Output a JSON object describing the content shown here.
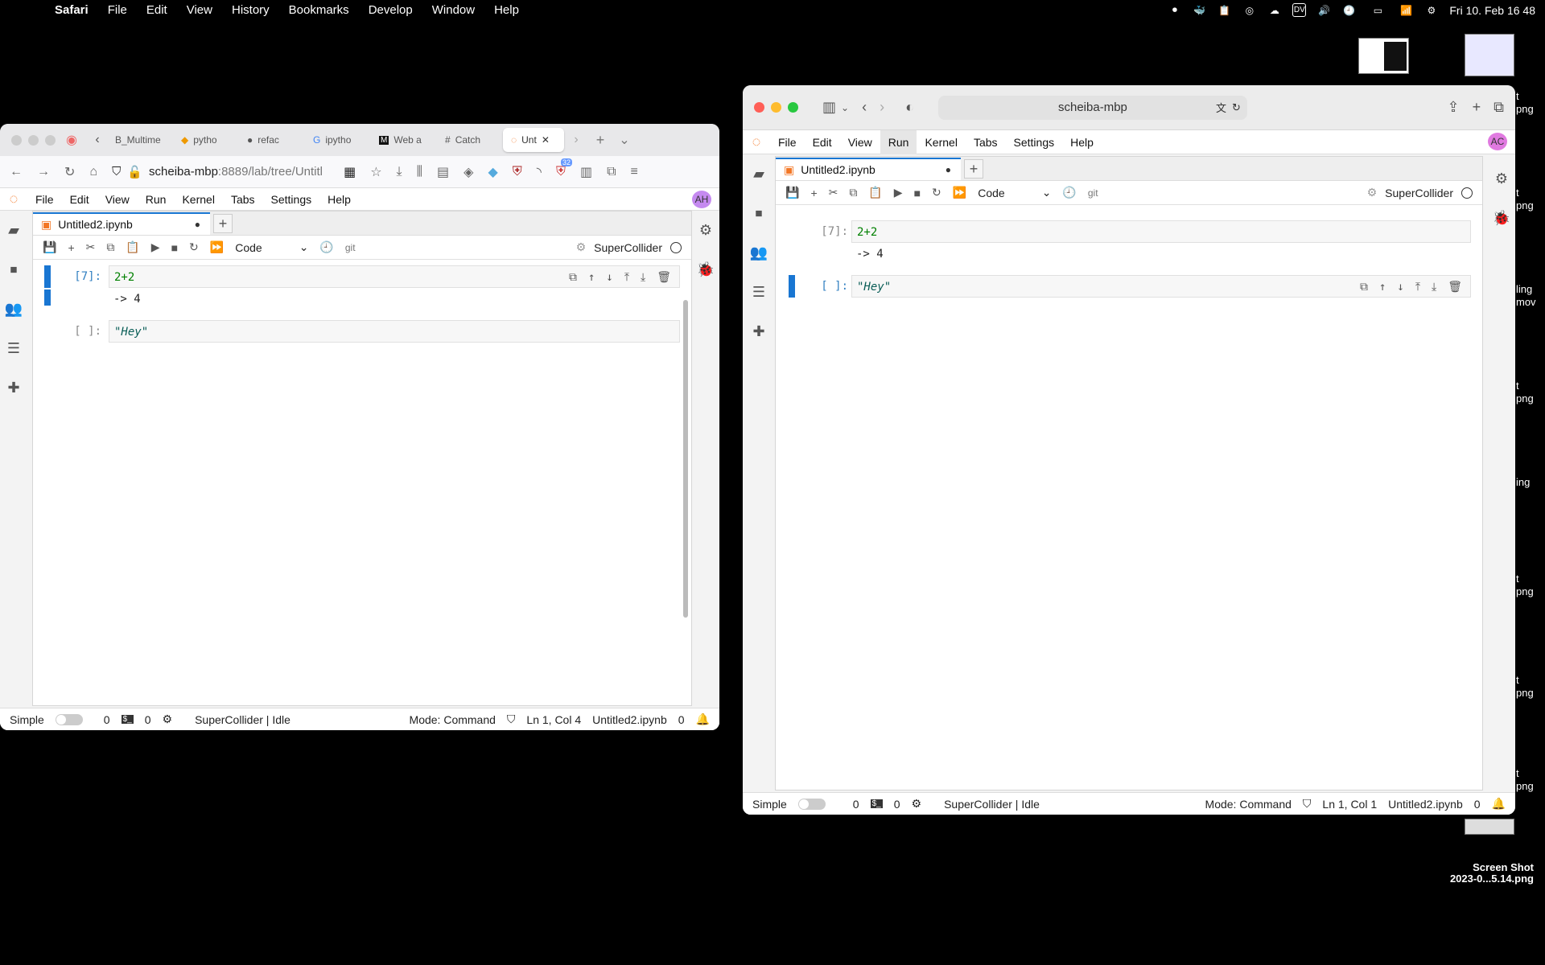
{
  "menubar": {
    "app": "Safari",
    "items": [
      "File",
      "Edit",
      "View",
      "History",
      "Bookmarks",
      "Develop",
      "Window",
      "Help"
    ],
    "datetime": "Fri 10. Feb 16 48",
    "status_icons": [
      "record-icon",
      "docker-icon",
      "clipboard-icon",
      "circle-icon",
      "cloud-icon",
      "dv-badge",
      "volume-icon",
      "timemachine-icon",
      "battery-icon",
      "wifi-icon",
      "control-center-icon"
    ],
    "dv_label": "DV"
  },
  "desktop": {
    "screenshot_label_line1": "Screen Shot",
    "screenshot_label_line2": "2023-0...5.14.png",
    "frags": [
      "t",
      "png",
      "t",
      "png",
      "ling",
      "mov",
      "t",
      "png",
      "ing",
      "t",
      "png",
      "ng",
      "t",
      "png",
      "t",
      "png"
    ]
  },
  "firefox": {
    "tabs": [
      "B_Multime",
      "pytho",
      "refac",
      "ipytho",
      "Web a",
      "Catch",
      "Unt"
    ],
    "url_host": "scheiba-mbp",
    "url_rest": ":8889/lab/tree/Untitl",
    "badge": "32"
  },
  "safari": {
    "url": "scheiba-mbp"
  },
  "jupyter_left": {
    "menu": [
      "File",
      "Edit",
      "View",
      "Run",
      "Kernel",
      "Tabs",
      "Settings",
      "Help"
    ],
    "avatar": "AH",
    "tab_title": "Untitled2.ipynb",
    "cell_type": "Code",
    "git": "git",
    "kernel": "SuperCollider",
    "cells": [
      {
        "prompt": "[7]:",
        "source": "2+2",
        "output": "-> 4"
      },
      {
        "prompt": "[ ]:",
        "source": "\"Hey\"",
        "output": ""
      }
    ],
    "status": {
      "simple": "Simple",
      "count1": "0",
      "count2": "0",
      "kernel_state": "SuperCollider | Idle",
      "mode": "Mode: Command",
      "position": "Ln 1, Col 4",
      "file": "Untitled2.ipynb",
      "notif": "0"
    }
  },
  "jupyter_right": {
    "menu": [
      "File",
      "Edit",
      "View",
      "Run",
      "Kernel",
      "Tabs",
      "Settings",
      "Help"
    ],
    "avatar": "AC",
    "tab_title": "Untitled2.ipynb",
    "cell_type": "Code",
    "git": "git",
    "kernel": "SuperCollider",
    "cells": [
      {
        "prompt": "[7]:",
        "source": "2+2",
        "output": "-> 4"
      },
      {
        "prompt": "[ ]:",
        "source": "\"Hey\"",
        "output": ""
      }
    ],
    "status": {
      "simple": "Simple",
      "count1": "0",
      "count2": "0",
      "kernel_state": "SuperCollider | Idle",
      "mode": "Mode: Command",
      "position": "Ln 1, Col 1",
      "file": "Untitled2.ipynb",
      "notif": "0"
    }
  }
}
